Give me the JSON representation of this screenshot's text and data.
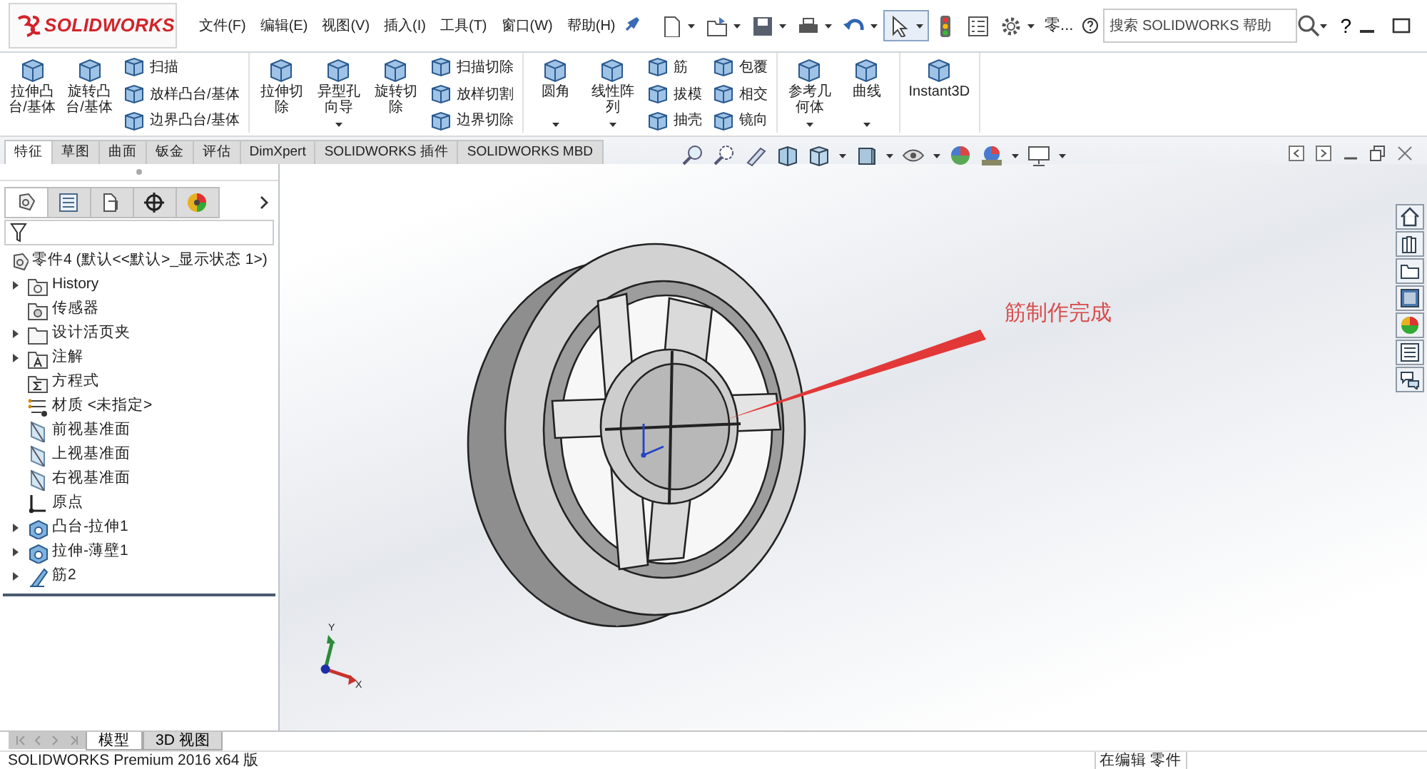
{
  "app": {
    "logo": "SOLIDWORKS"
  },
  "menu": [
    "文件(F)",
    "编辑(E)",
    "视图(V)",
    "插入(I)",
    "工具(T)",
    "窗口(W)",
    "帮助(H)"
  ],
  "quick_access": [
    {
      "kind": "new",
      "dropdown": true,
      "selected": false
    },
    {
      "kind": "open",
      "dropdown": true,
      "selected": false
    },
    {
      "kind": "save",
      "dropdown": true,
      "selected": false
    },
    {
      "kind": "print",
      "dropdown": true,
      "selected": false
    },
    {
      "kind": "undo",
      "dropdown": true,
      "selected": false
    },
    {
      "kind": "select",
      "dropdown": true,
      "selected": true
    },
    {
      "kind": "rebuild",
      "dropdown": false,
      "selected": false
    },
    {
      "kind": "list",
      "dropdown": false,
      "selected": false
    },
    {
      "kind": "gear",
      "dropdown": true,
      "selected": false
    }
  ],
  "document_name": "零...",
  "search": {
    "placeholder": "搜索 SOLIDWORKS 帮助"
  },
  "help": "?",
  "ribbon": [
    {
      "columns": [
        {
          "kind": "large",
          "label": "拉伸凸台/基体",
          "dropdown": false
        },
        {
          "kind": "large",
          "label": "旋转凸台/基体",
          "dropdown": false
        },
        {
          "kind": "stack",
          "items": [
            "扫描",
            "放样凸台/基体",
            "边界凸台/基体"
          ]
        }
      ]
    },
    {
      "columns": [
        {
          "kind": "large",
          "label": "拉伸切除",
          "dropdown": false
        },
        {
          "kind": "large",
          "label": "异型孔向导",
          "dropdown": true
        },
        {
          "kind": "large",
          "label": "旋转切除",
          "dropdown": false
        },
        {
          "kind": "stack",
          "items": [
            "扫描切除",
            "放样切割",
            "边界切除"
          ]
        }
      ]
    },
    {
      "columns": [
        {
          "kind": "large",
          "label": "圆角",
          "dropdown": true
        },
        {
          "kind": "large",
          "label": "线性阵列",
          "dropdown": true
        },
        {
          "kind": "stack",
          "items": [
            "筋",
            "拔模",
            "抽壳"
          ]
        },
        {
          "kind": "stack",
          "items": [
            "包覆",
            "相交",
            "镜向"
          ]
        }
      ]
    },
    {
      "columns": [
        {
          "kind": "large",
          "label": "参考几何体",
          "dropdown": true
        },
        {
          "kind": "large",
          "label": "曲线",
          "dropdown": true
        }
      ]
    },
    {
      "columns": [
        {
          "kind": "large",
          "label": "Instant3D",
          "dropdown": false
        }
      ]
    }
  ],
  "tabs": [
    {
      "label": "特征",
      "selected": true
    },
    {
      "label": "草图",
      "selected": false
    },
    {
      "label": "曲面",
      "selected": false
    },
    {
      "label": "钣金",
      "selected": false
    },
    {
      "label": "评估",
      "selected": false
    },
    {
      "label": "DimXpert",
      "selected": false
    },
    {
      "label": "SOLIDWORKS 插件",
      "selected": false
    },
    {
      "label": "SOLIDWORKS MBD",
      "selected": false
    }
  ],
  "panel_tabs": [
    {
      "kind": "feature",
      "selected": true
    },
    {
      "kind": "property",
      "selected": false
    },
    {
      "kind": "config",
      "selected": false
    },
    {
      "kind": "dimxpert",
      "selected": false
    },
    {
      "kind": "display",
      "selected": false
    }
  ],
  "tree": {
    "root": "零件4  (默认<<默认>_显示状态 1>)",
    "items": [
      {
        "kind": "history",
        "label": "History",
        "has_children": true
      },
      {
        "kind": "sensor",
        "label": "传感器",
        "has_children": false
      },
      {
        "kind": "folder",
        "label": "设计活页夹",
        "has_children": true
      },
      {
        "kind": "annotation",
        "label": "注解",
        "has_children": true
      },
      {
        "kind": "equation",
        "label": "方程式",
        "has_children": false
      },
      {
        "kind": "material",
        "label": "材质 <未指定>",
        "has_children": false
      },
      {
        "kind": "plane",
        "label": "前视基准面",
        "has_children": false
      },
      {
        "kind": "plane",
        "label": "上视基准面",
        "has_children": false
      },
      {
        "kind": "plane",
        "label": "右视基准面",
        "has_children": false
      },
      {
        "kind": "origin",
        "label": "原点",
        "has_children": false
      },
      {
        "kind": "feature",
        "label": "凸台-拉伸1",
        "has_children": true
      },
      {
        "kind": "feature",
        "label": "拉伸-薄壁1",
        "has_children": true
      },
      {
        "kind": "rib",
        "label": "筋2",
        "has_children": true
      }
    ]
  },
  "annotation": "筋制作完成",
  "triad": {
    "y": "Y",
    "x": "X"
  },
  "bottom_tabs": [
    {
      "label": "模型",
      "selected": true
    },
    {
      "label": "3D 视图",
      "selected": false
    }
  ],
  "status_bar": {
    "left": "SOLIDWORKS Premium 2016 x64 版",
    "right": "在编辑 零件"
  }
}
